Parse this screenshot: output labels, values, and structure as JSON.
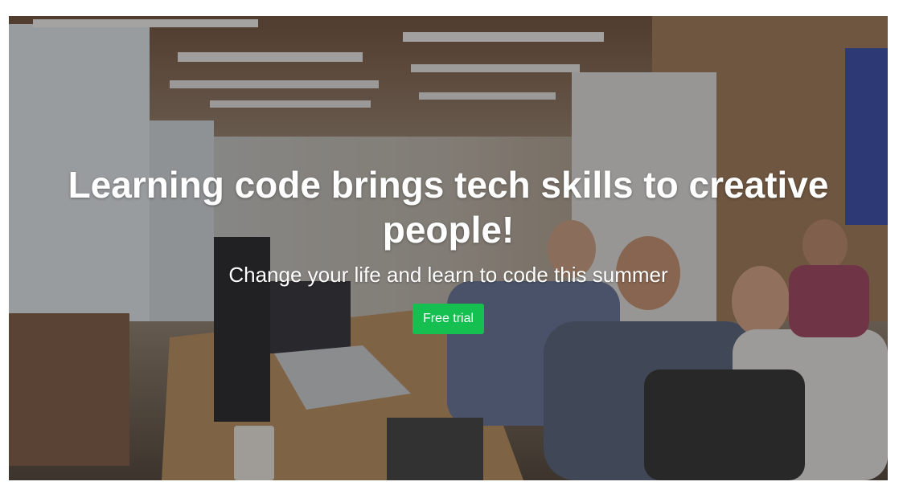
{
  "hero": {
    "title": "Learning code brings tech skills to creative people!",
    "subtitle": "Change your life and learn to code this summer",
    "cta_label": "Free trial",
    "background_image": "office-coworking-photo",
    "overlay_color": "#2a2422"
  },
  "colors": {
    "cta": "#16c050",
    "text": "#ffffff"
  }
}
